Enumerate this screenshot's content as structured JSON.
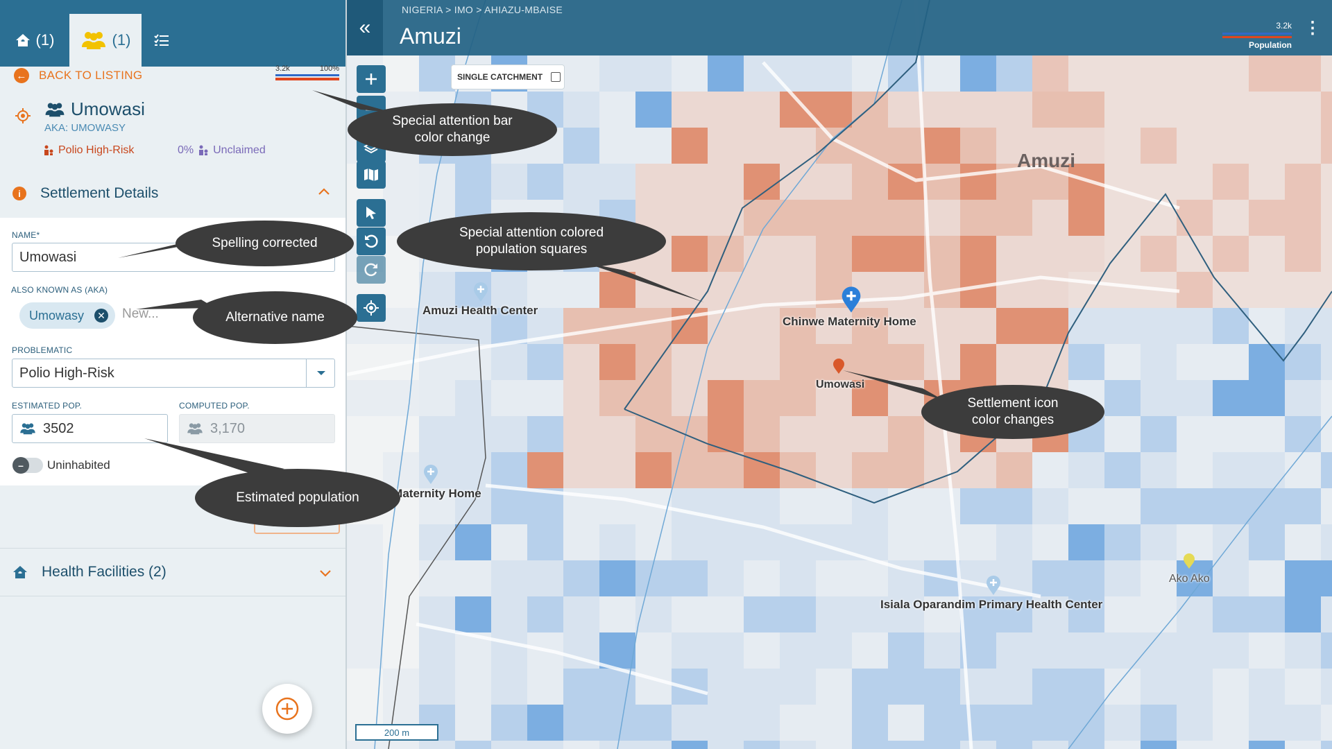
{
  "tabs": {
    "facilities_count": "(1)",
    "settlements_count": "(1)"
  },
  "panel": {
    "back_label": "BACK TO LISTING",
    "minibar": {
      "value": "3.2k",
      "percent": "100%"
    },
    "settlement_name": "Umowasi",
    "aka_line": "AKA: UMOWASY",
    "risk_label": "Polio High-Risk",
    "unclaimed_percent": "0%",
    "unclaimed_label": "Unclaimed",
    "details_title": "Settlement Details",
    "name_label": "NAME*",
    "name_value": "Umowasi",
    "aka_label": "ALSO KNOWN AS (AKA)",
    "aka_chip": "Umowasy",
    "aka_placeholder": "New...",
    "problematic_label": "PROBLEMATIC",
    "problematic_value": "Polio High-Risk",
    "estimated_label": "ESTIMATED POP.",
    "estimated_value": "3502",
    "computed_label": "COMPUTED POP.",
    "computed_value": "3,170",
    "uninhabited_label": "Uninhabited",
    "health_title": "Health Facilities (2)"
  },
  "map": {
    "breadcrumb": "NIGERIA  >  IMO  >  AHIAZU-MBAISE",
    "title": "Amuzi",
    "legend_value": "3.2k",
    "legend_label": "Population",
    "single_catchment": "SINGLE CATCHMENT",
    "scale": "200 m",
    "town_label": "Amuzi",
    "labels": {
      "amuzi_hc": "Amuzi Health Center",
      "chinwe": "Chinwe Maternity Home",
      "umowasi": "Umowasi",
      "maternity2": "a Maternity Home",
      "isiala": "Isiala Oparandim Primary Health Center",
      "akoako": "Ako Ako"
    }
  },
  "callouts": {
    "bar": "Special attention bar\ncolor change",
    "spelling": "Spelling corrected",
    "squares": "Special attention colored\npopulation squares",
    "altname": "Alternative name",
    "icon": "Settlement icon\ncolor changes",
    "estpop": "Estimated population"
  },
  "colors": {
    "primary": "#2b6f93",
    "accent": "#e8731d",
    "risk": "#c8471d",
    "pop_blue": "#4a90d9",
    "pop_red": "#d9704a"
  }
}
